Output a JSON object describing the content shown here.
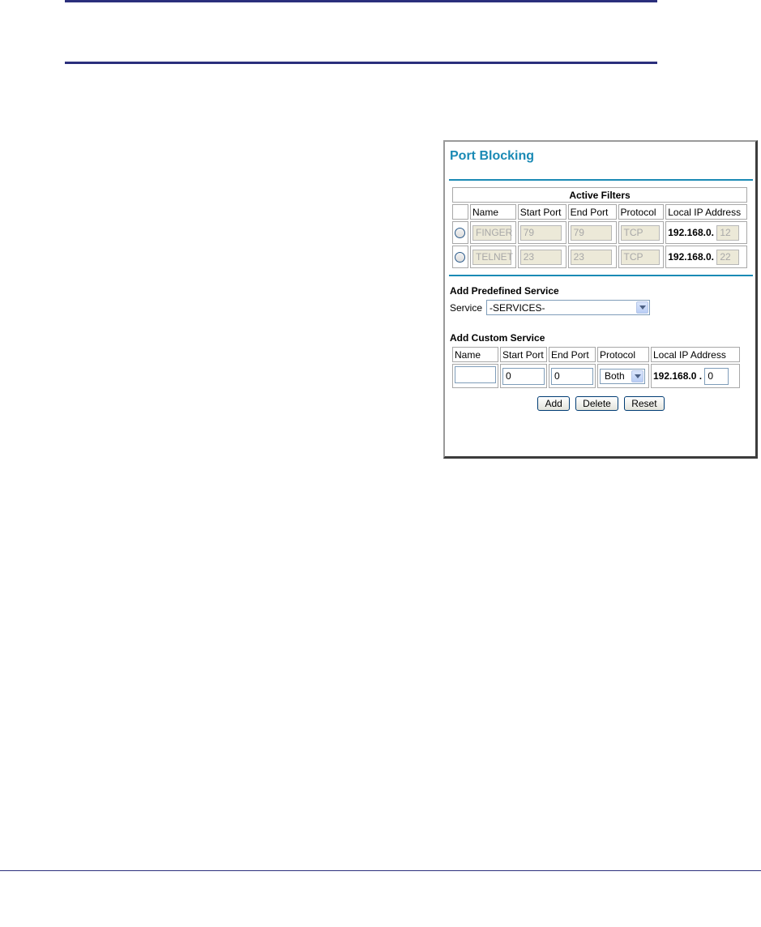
{
  "title": "Port Blocking",
  "active_filters": {
    "caption": "Active Filters",
    "headers": [
      "Name",
      "Start Port",
      "End Port",
      "Protocol",
      "Local IP Address"
    ],
    "rows": [
      {
        "name": "FINGER",
        "start_port": "79",
        "end_port": "79",
        "protocol": "TCP",
        "ip_prefix": "192.168.0.",
        "ip_suffix": "12"
      },
      {
        "name": "TELNET",
        "start_port": "23",
        "end_port": "23",
        "protocol": "TCP",
        "ip_prefix": "192.168.0.",
        "ip_suffix": "22"
      }
    ]
  },
  "predefined": {
    "heading": "Add Predefined Service",
    "service_label": "Service",
    "service_value": "-SERVICES-"
  },
  "custom": {
    "heading": "Add Custom Service",
    "headers": [
      "Name",
      "Start Port",
      "End Port",
      "Protocol",
      "Local IP Address"
    ],
    "name_value": "",
    "start_port_value": "0",
    "end_port_value": "0",
    "protocol_value": "Both",
    "ip_prefix": "192.168.0 .",
    "ip_suffix_value": "0"
  },
  "buttons": {
    "add": "Add",
    "delete": "Delete",
    "reset": "Reset"
  },
  "colors": {
    "accent": "#1a8ab5",
    "rule": "#2b2f7c"
  }
}
